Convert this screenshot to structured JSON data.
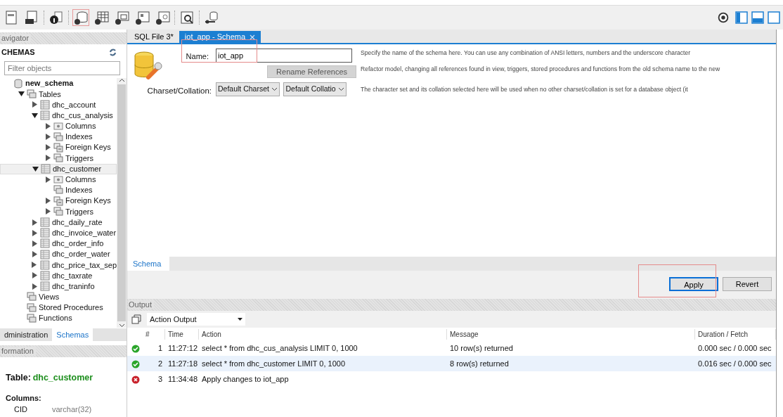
{
  "toolbar": {
    "left_icons": [
      {
        "kind": "sql-new"
      },
      {
        "kind": "sql-open"
      },
      {
        "kind": "info"
      },
      {
        "kind": "schema-add",
        "selected": true
      },
      {
        "kind": "table-add",
        "selected": false
      },
      {
        "kind": "view-add",
        "selected": false
      },
      {
        "kind": "proc-add",
        "selected": false
      },
      {
        "kind": "func-add",
        "selected": false
      },
      {
        "kind": "inspect",
        "selected": false
      },
      {
        "kind": "reconnect",
        "selected": false
      }
    ],
    "right_icons": [
      {
        "kind": "gear"
      },
      {
        "kind": "panel-left",
        "selected": true
      },
      {
        "kind": "panel-bottom",
        "selected": true
      },
      {
        "kind": "panel-right",
        "selected": false
      }
    ]
  },
  "navigator": {
    "title": "avigator",
    "section": "CHEMAS",
    "filter": {
      "placeholder": "Filter objects"
    },
    "tree": [
      {
        "label": "new_schema",
        "kind": "schema",
        "selected": false,
        "children": [
          {
            "label": "Tables",
            "kind": "folder",
            "expandable": true,
            "expanded": true,
            "selected": false,
            "children": [
              {
                "label": "dhc_account",
                "kind": "table",
                "expandable": true,
                "expanded": false,
                "selected": false
              },
              {
                "label": "dhc_cus_analysis",
                "kind": "table",
                "expandable": true,
                "expanded": true,
                "selected": false,
                "children": [
                  {
                    "label": "Columns",
                    "kind": "columns",
                    "expandable": true,
                    "expanded": false,
                    "selected": false
                  },
                  {
                    "label": "Indexes",
                    "kind": "folder",
                    "expandable": true,
                    "expanded": false,
                    "selected": false
                  },
                  {
                    "label": "Foreign Keys",
                    "kind": "fkeys",
                    "expandable": true,
                    "expanded": false,
                    "selected": false
                  },
                  {
                    "label": "Triggers",
                    "kind": "folder",
                    "expandable": true,
                    "expanded": false,
                    "selected": false
                  }
                ]
              },
              {
                "label": "dhc_customer",
                "kind": "table",
                "expandable": true,
                "expanded": true,
                "selected": true,
                "children": [
                  {
                    "label": "Columns",
                    "kind": "columns",
                    "expandable": true,
                    "expanded": false,
                    "selected": false
                  },
                  {
                    "label": "Indexes",
                    "kind": "folder",
                    "selected": false
                  },
                  {
                    "label": "Foreign Keys",
                    "kind": "fkeys",
                    "expandable": true,
                    "expanded": false,
                    "selected": false
                  },
                  {
                    "label": "Triggers",
                    "kind": "folder",
                    "expandable": true,
                    "expanded": false,
                    "selected": false
                  }
                ]
              },
              {
                "label": "dhc_daily_rate",
                "kind": "table",
                "expandable": true,
                "expanded": false,
                "selected": false
              },
              {
                "label": "dhc_invoice_water",
                "kind": "table",
                "expandable": true,
                "expanded": false,
                "selected": false
              },
              {
                "label": "dhc_order_info",
                "kind": "table",
                "expandable": true,
                "expanded": false,
                "selected": false
              },
              {
                "label": "dhc_order_water",
                "kind": "table",
                "expandable": true,
                "expanded": false,
                "selected": false
              },
              {
                "label": "dhc_price_tax_sep",
                "kind": "table",
                "expandable": true,
                "expanded": false,
                "selected": false
              },
              {
                "label": "dhc_taxrate",
                "kind": "table",
                "expandable": true,
                "expanded": false,
                "selected": false
              },
              {
                "label": "dhc_traninfo",
                "kind": "table",
                "expandable": true,
                "expanded": false,
                "selected": false
              }
            ]
          },
          {
            "label": "Views",
            "kind": "folder",
            "selected": false
          },
          {
            "label": "Stored Procedures",
            "kind": "folder",
            "selected": false
          },
          {
            "label": "Functions",
            "kind": "folder",
            "selected": false
          }
        ]
      }
    ],
    "tabs": [
      {
        "label": "dministration",
        "selected": false
      },
      {
        "label": "Schemas",
        "selected": true
      }
    ]
  },
  "information": {
    "title": "formation",
    "table_label": "Table:",
    "table_name": "dhc_customer",
    "columns_label": "Columns:",
    "columns": [
      {
        "name": "CID",
        "type": "varchar(32)"
      }
    ]
  },
  "editor_tabs": [
    {
      "label": "SQL File 3*",
      "selected": false,
      "closable": false
    },
    {
      "label": "iot_app - Schema",
      "selected": true,
      "closable": true
    }
  ],
  "schema_form": {
    "name_label": "Name:",
    "name_value": "iot_app",
    "rename_button": "Rename References",
    "charset_label": "Charset/Collation:",
    "charset": "Default Charset",
    "collation": "Default Collatio",
    "hints": [
      "Specify the name of the schema here. You can use any combination of ANSI letters, numbers and the underscore character",
      "Refactor model, changing all references found in view, triggers, stored procedures and functions from the old schema name to the new",
      "The character set and its collation selected here will be used when no other charset/collation is set for a database object (it"
    ]
  },
  "bottom_tabs": [
    {
      "label": "Schema",
      "selected": true
    }
  ],
  "buttons": [
    {
      "label": "Apply",
      "selected": true
    },
    {
      "label": "Revert",
      "selected": false
    }
  ],
  "output": {
    "title": "Output",
    "selector": "Action Output",
    "columns": [
      "#",
      "Time",
      "Action",
      "Message",
      "Duration / Fetch"
    ],
    "rows": [
      {
        "kind": "success",
        "n": "1",
        "time": "11:27:12",
        "action": "select * from dhc_cus_analysis LIMIT 0, 1000",
        "message": "10 row(s) returned",
        "duration": "0.000 sec / 0.000 sec",
        "selected": false
      },
      {
        "kind": "success",
        "n": "2",
        "time": "11:27:18",
        "action": "select * from dhc_customer LIMIT 0, 1000",
        "message": "8 row(s) returned",
        "duration": "0.016 sec / 0.000 sec",
        "selected": true
      },
      {
        "kind": "error",
        "n": "3",
        "time": "11:34:48",
        "action": "Apply changes to iot_app",
        "message": "",
        "duration": "",
        "selected": false
      }
    ]
  }
}
